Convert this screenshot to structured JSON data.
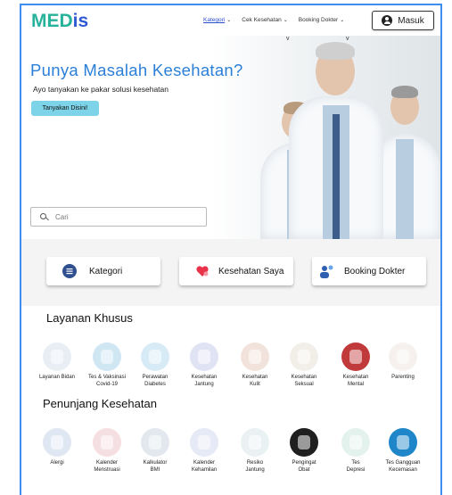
{
  "nav": {
    "logo_part1": "MED",
    "logo_part2": "is",
    "links": [
      {
        "label": "Kategori",
        "active": true
      },
      {
        "label": "Cek Kesehatan",
        "active": false
      },
      {
        "label": "Booking Dokter",
        "active": false
      }
    ],
    "login_label": "Masuk"
  },
  "hero": {
    "title": "Punya Masalah Kesehatan?",
    "subtitle": "Ayo tanyakan ke pakar solusi kesehatan",
    "cta_label": "Tanyakan Disini!",
    "marks": [
      "v",
      "v"
    ],
    "search_placeholder": "Cari"
  },
  "quick": [
    {
      "label": "Kategori",
      "icon": "list-icon"
    },
    {
      "label": "Kesehatan Saya",
      "icon": "heart-icon"
    },
    {
      "label": "Booking Dokter",
      "icon": "doctor-icon"
    }
  ],
  "layanan": {
    "title": "Layanan Khusus",
    "items": [
      {
        "line1": "Layanan Bidan",
        "line2": "",
        "color": "#e9eef5",
        "icon": "midwife-icon"
      },
      {
        "line1": "Tes & Vaksinasi",
        "line2": "Covid-19",
        "color": "#cfe6f3",
        "icon": "vaccine-icon"
      },
      {
        "line1": "Perawatan",
        "line2": "Diabetes",
        "color": "#d6ebf5",
        "icon": "glucometer-icon"
      },
      {
        "line1": "Kesehatan",
        "line2": "Jantung",
        "color": "#dfe3f3",
        "icon": "heart-organ-icon"
      },
      {
        "line1": "Kesehatan",
        "line2": "Kulit",
        "color": "#f1e3dc",
        "icon": "skin-icon"
      },
      {
        "line1": "Kesehatan",
        "line2": "Seksual",
        "color": "#f2efe9",
        "icon": "couple-icon"
      },
      {
        "line1": "Kesehatan",
        "line2": "Mental",
        "color": "#c0393b",
        "icon": "mental-icon"
      },
      {
        "line1": "Parenting",
        "line2": "",
        "color": "#f6f1ee",
        "icon": "family-icon"
      }
    ]
  },
  "penunjang": {
    "title": "Penunjang Kesehatan",
    "items": [
      {
        "line1": "Alergi",
        "line2": "",
        "color": "#dfe7f3",
        "icon": "allergy-icon"
      },
      {
        "line1": "Kalender",
        "line2": "Menstruasi",
        "color": "#f5dfe3",
        "icon": "calendar-icon"
      },
      {
        "line1": "Kalkulator",
        "line2": "BMI",
        "color": "#e3e8ef",
        "icon": "calculator-icon"
      },
      {
        "line1": "Kalender",
        "line2": "Kehamilan",
        "color": "#e6e9f6",
        "icon": "pregnancy-icon"
      },
      {
        "line1": "Resiko",
        "line2": "Jantung",
        "color": "#e9f1f3",
        "icon": "heart-risk-icon"
      },
      {
        "line1": "Pengingat",
        "line2": "Obat",
        "color": "#1f1f1f",
        "icon": "pill-icon"
      },
      {
        "line1": "Tes",
        "line2": "Depresi",
        "color": "#e4f2ee",
        "icon": "depression-icon"
      },
      {
        "line1": "Tes Gangguan",
        "line2": "Kecemasan",
        "color": "#1e86c9",
        "icon": "anxiety-icon"
      }
    ]
  }
}
